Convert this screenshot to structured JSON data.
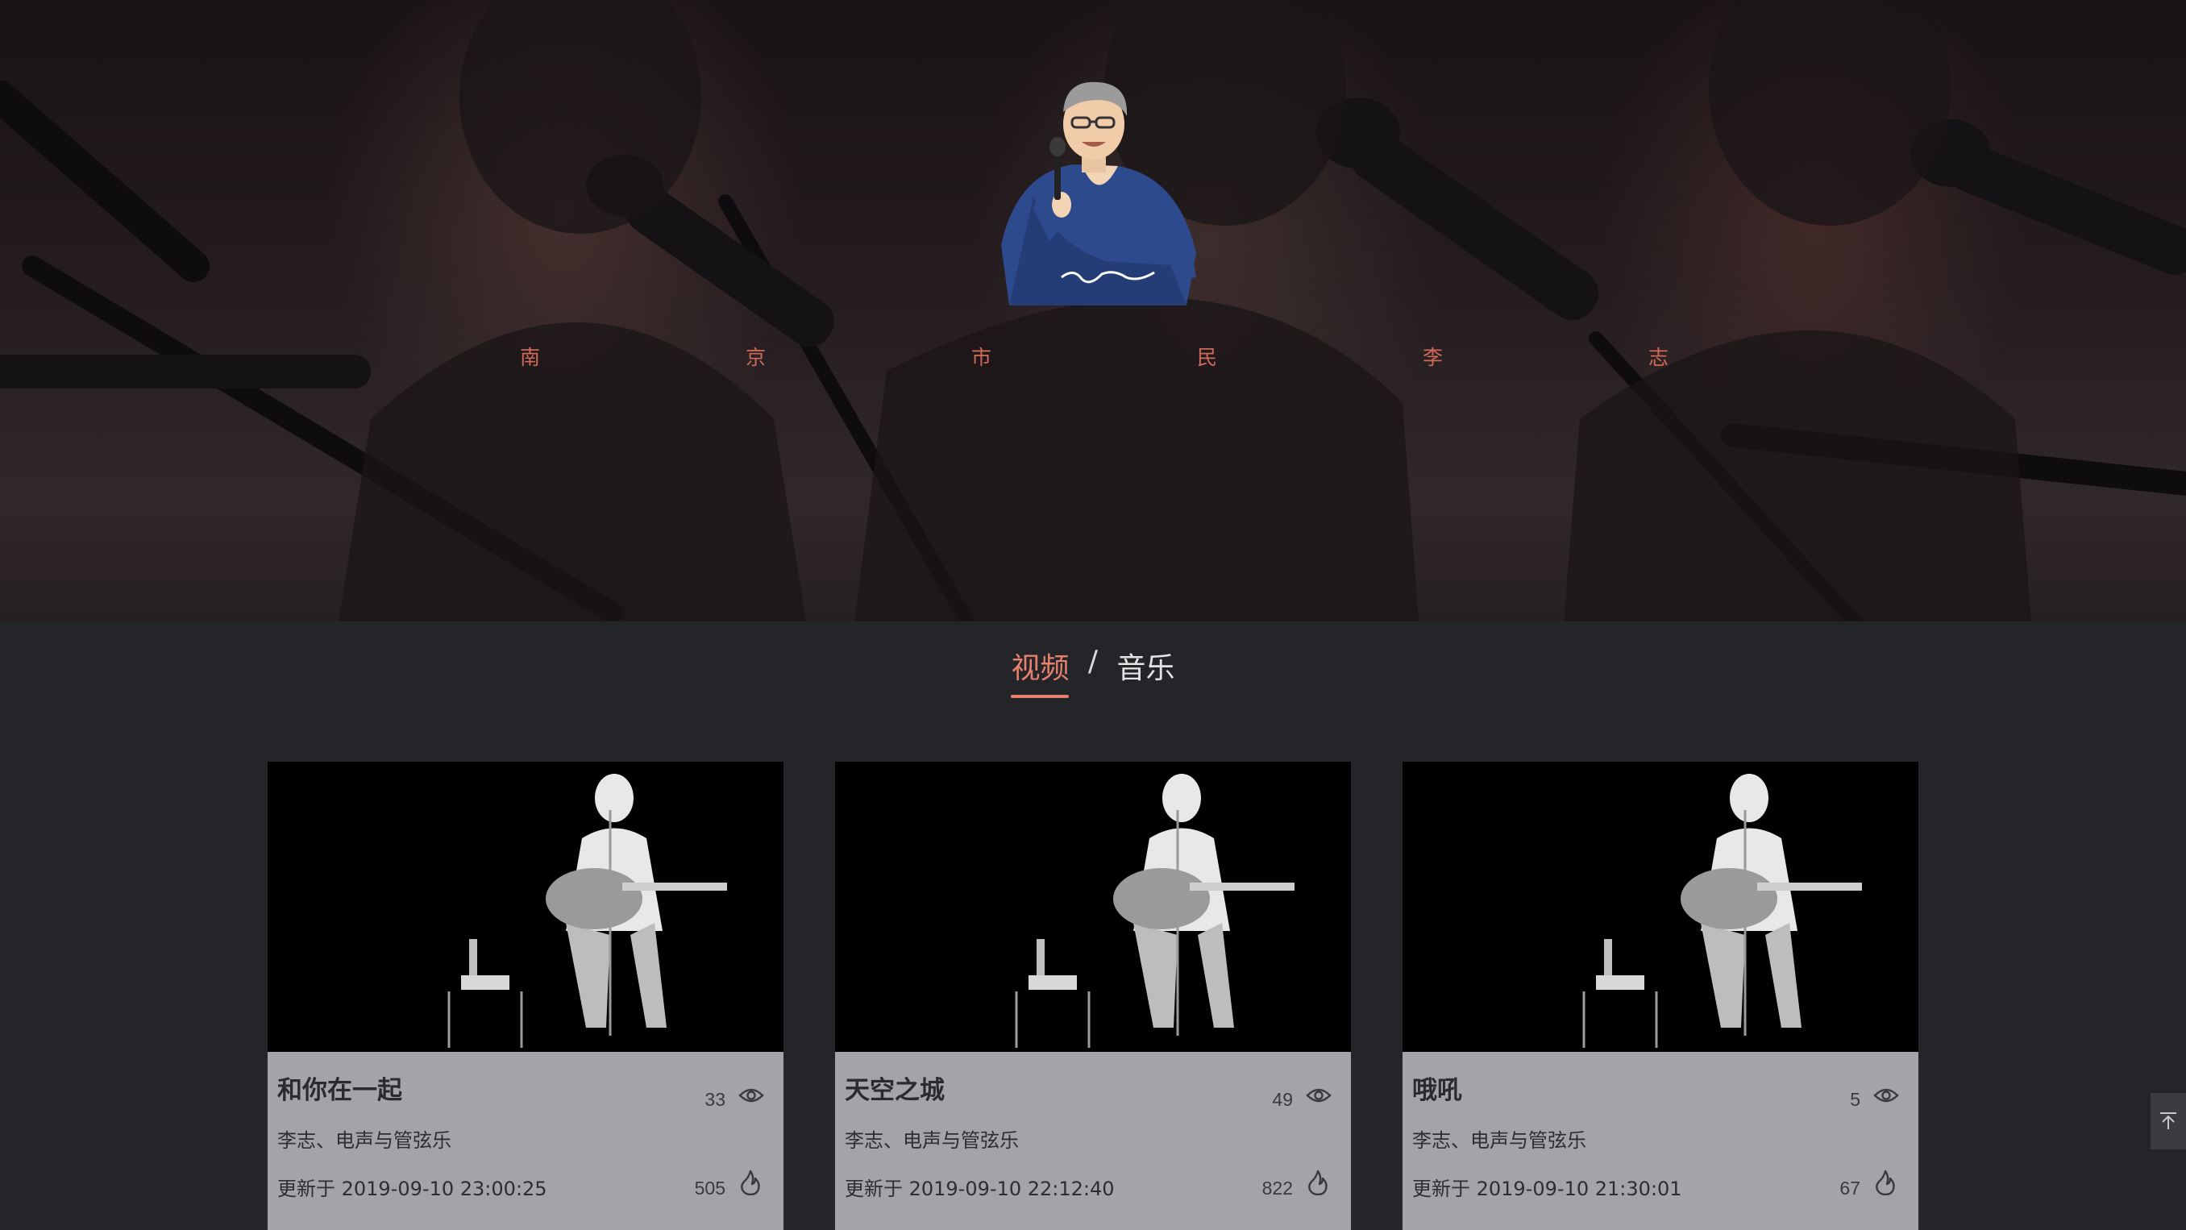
{
  "hero": {
    "title_chars": [
      "南",
      "京",
      "市",
      "民",
      "李",
      "志"
    ],
    "avatar_icon": "singer-with-microphone-illustration"
  },
  "tabs": {
    "video_label": "视频",
    "separator": "/",
    "music_label": "音乐",
    "active": "video"
  },
  "cards": [
    {
      "title": "和你在一起",
      "views": "33",
      "artist": "李志、电声与管弦乐",
      "updated": "更新于 2019-09-10 23:00:25",
      "likes": "505"
    },
    {
      "title": "天空之城",
      "views": "49",
      "artist": "李志、电声与管弦乐",
      "updated": "更新于 2019-09-10 22:12:40",
      "likes": "822"
    },
    {
      "title": "哦吼",
      "views": "5",
      "artist": "李志、电声与管弦乐",
      "updated": "更新于 2019-09-10 21:30:01",
      "likes": "67"
    }
  ],
  "colors": {
    "accent": "#e8806e",
    "page_bg": "#232529",
    "card_bg": "#a3a4a9"
  },
  "icons": {
    "views": "eye-icon",
    "likes": "flame-icon",
    "back_to_top": "arrow-up-to-top-icon"
  }
}
